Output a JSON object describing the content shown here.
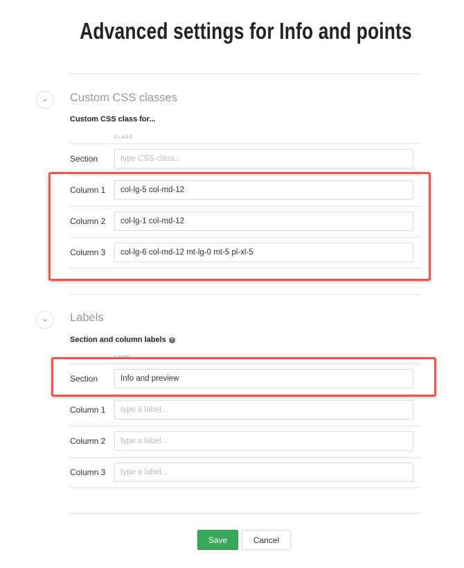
{
  "title": "Advanced settings for Info and points",
  "css_section": {
    "title": "Custom CSS classes",
    "subtitle": "Custom CSS class for...",
    "column_header": "CLASS",
    "rows": [
      {
        "label": "Section",
        "value": "",
        "placeholder": "type CSS class..."
      },
      {
        "label": "Column 1",
        "value": "col-lg-5 col-md-12",
        "placeholder": "type CSS class..."
      },
      {
        "label": "Column 2",
        "value": "col-lg-1 col-md-12",
        "placeholder": "type CSS class..."
      },
      {
        "label": "Column 3",
        "value": "col-lg-6 col-md-12 mt-lg-0 mt-5 pl-xl-5",
        "placeholder": "type CSS class..."
      }
    ]
  },
  "labels_section": {
    "title": "Labels",
    "subtitle": "Section and column labels",
    "help_icon": "question-circle-icon",
    "column_header": "LABEL",
    "rows": [
      {
        "label": "Section",
        "value": "Info and preview",
        "placeholder": "type a label..."
      },
      {
        "label": "Column 1",
        "value": "",
        "placeholder": "type a label..."
      },
      {
        "label": "Column 2",
        "value": "",
        "placeholder": "type a label..."
      },
      {
        "label": "Column 3",
        "value": "",
        "placeholder": "type a label..."
      }
    ]
  },
  "buttons": {
    "save": "Save",
    "cancel": "Cancel"
  },
  "colors": {
    "save": "#3aa85a",
    "highlight": "#f25546"
  }
}
